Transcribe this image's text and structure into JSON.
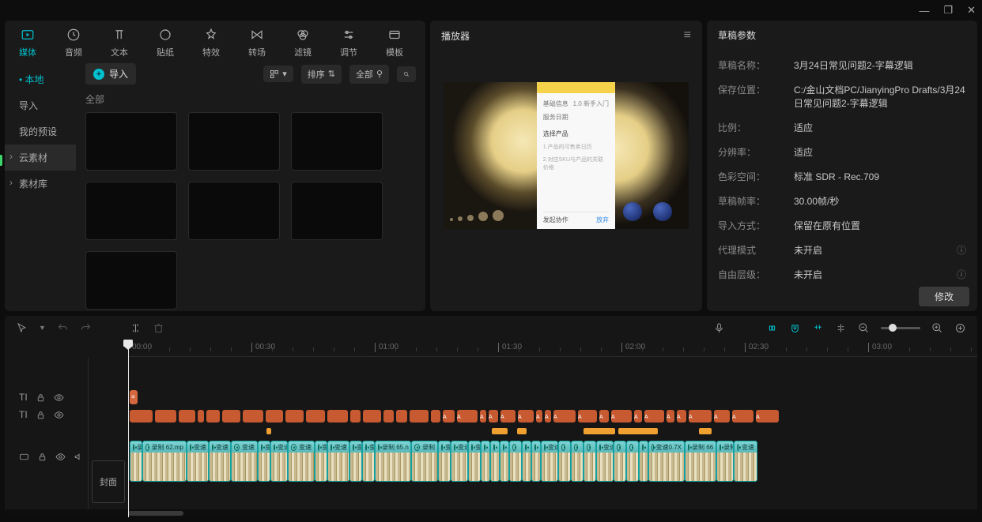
{
  "titlebar": {
    "min": "—",
    "max": "❐",
    "close": "✕"
  },
  "topTabs": [
    {
      "label": "媒体",
      "active": true
    },
    {
      "label": "音频"
    },
    {
      "label": "文本"
    },
    {
      "label": "贴纸"
    },
    {
      "label": "特效"
    },
    {
      "label": "转场"
    },
    {
      "label": "滤镜"
    },
    {
      "label": "调节"
    },
    {
      "label": "模板"
    }
  ],
  "sideNav": [
    {
      "label": "本地",
      "mode": "active"
    },
    {
      "label": "导入"
    },
    {
      "label": "我的预设"
    },
    {
      "label": "云素材",
      "mode": "selected expand"
    },
    {
      "label": "素材库",
      "mode": "expand"
    }
  ],
  "mediaTools": {
    "import": "导入",
    "sort": "排序",
    "all": "全部",
    "allLabel": "全部"
  },
  "player": {
    "title": "播放器"
  },
  "previewForm": {
    "r1k": "基础信息",
    "r1v": "1.0 新手入门",
    "r2k": "服务日期",
    "r2v": "",
    "sec": "选择产品",
    "desc1": "1.产品的可售卖日历",
    "desc2": "2.对应SKU与产品的关联价格",
    "footLabel": "发起协作",
    "footBtn": "放弃"
  },
  "props": {
    "title": "草稿参数",
    "rows": [
      {
        "k": "草稿名称：",
        "v": "3月24日常见问题2-字幕逻辑"
      },
      {
        "k": "保存位置：",
        "v": "C:/金山文档PC/JianyingPro Drafts/3月24日常见问题2-字幕逻辑"
      },
      {
        "k": "比例：",
        "v": "适应"
      },
      {
        "k": "分辨率：",
        "v": "适应"
      },
      {
        "k": "色彩空间：",
        "v": "标准 SDR - Rec.709"
      },
      {
        "k": "草稿帧率：",
        "v": "30.00帧/秒"
      },
      {
        "k": "导入方式：",
        "v": "保留在原有位置"
      },
      {
        "k": "代理模式",
        "v": "未开启",
        "info": true
      },
      {
        "k": "自由层级：",
        "v": "未开启",
        "info": true
      }
    ],
    "modify": "修改"
  },
  "ruler": [
    "00:00",
    "00:30",
    "01:00",
    "01:30",
    "02:00",
    "02:30",
    "03:00"
  ],
  "cover": "封面",
  "clipLabels": {
    "rec62": "录制 62.mp",
    "speed": "变速",
    "rec65": "录制 65.n",
    "rec66": "录制 66",
    "speed07": "变速0.7X",
    "rec": "录制",
    "speedShort": "变"
  }
}
